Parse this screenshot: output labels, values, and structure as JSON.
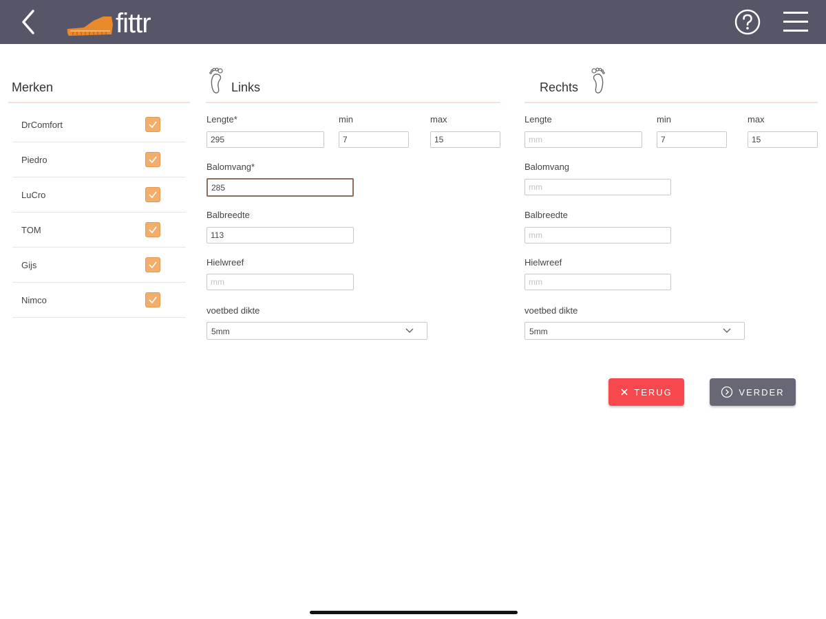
{
  "header": {
    "logo_text": "fittr",
    "icons": [
      "chevron-left-icon",
      "shoe-logo-icon",
      "help-circle-icon",
      "hamburger-menu-icon"
    ]
  },
  "brands": {
    "title": "Merken",
    "items": [
      {
        "label": "DrComfort",
        "checked": true
      },
      {
        "label": "Piedro",
        "checked": true
      },
      {
        "label": "LuCro",
        "checked": true
      },
      {
        "label": "TOM",
        "checked": true
      },
      {
        "label": "Gijs",
        "checked": true
      },
      {
        "label": "Nimco",
        "checked": true
      }
    ]
  },
  "left": {
    "title": "Links",
    "lengte_label": "Lengte*",
    "lengte_value": "295",
    "min_label": "min",
    "min_value": "7",
    "max_label": "max",
    "max_value": "15",
    "balomvang_label": "Balomvang*",
    "balomvang_value": "285",
    "balbreedte_label": "Balbreedte",
    "balbreedte_value": "113",
    "hielwreef_label": "Hielwreef",
    "hielwreef_placeholder": "mm",
    "voetbed_label": "voetbed dikte",
    "voetbed_value": "5mm"
  },
  "right": {
    "title": "Rechts",
    "lengte_label": "Lengte",
    "lengte_placeholder": "mm",
    "min_label": "min",
    "min_value": "7",
    "max_label": "max",
    "max_value": "15",
    "balomvang_label": "Balomvang",
    "balomvang_placeholder": "mm",
    "balbreedte_label": "Balbreedte",
    "balbreedte_placeholder": "mm",
    "hielwreef_label": "Hielwreef",
    "hielwreef_placeholder": "mm",
    "voetbed_label": "voetbed dikte",
    "voetbed_value": "5mm"
  },
  "actions": {
    "back_label": "TERUG",
    "next_label": "VERDER"
  },
  "colors": {
    "header": "#575568",
    "accent": "#f2ae6a",
    "danger": "#f7484d",
    "secondary": "#686776"
  }
}
